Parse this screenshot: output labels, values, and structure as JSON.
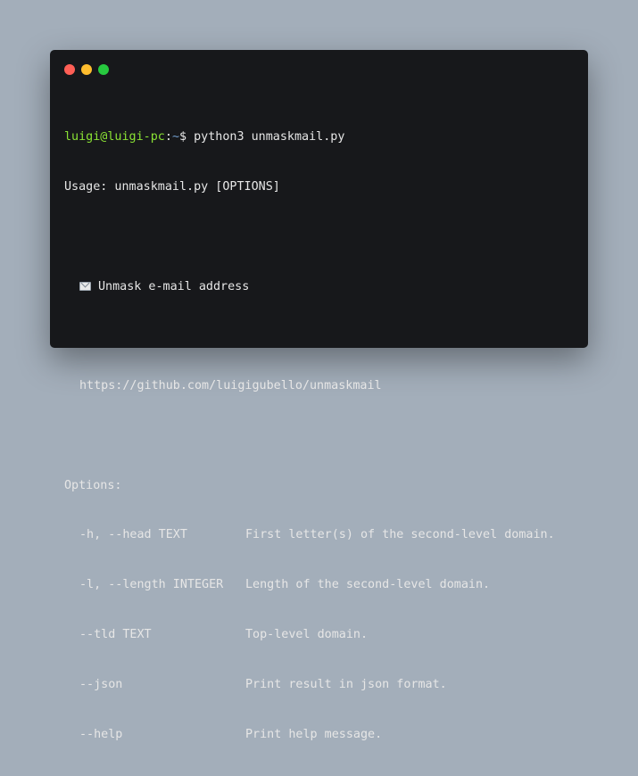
{
  "window": {
    "controls": [
      "close",
      "minimize",
      "maximize"
    ],
    "colors": {
      "close": "#ff5f56",
      "minimize": "#ffbd2e",
      "maximize": "#27c93f"
    }
  },
  "terminal": {
    "prompt": {
      "user": "luigi@luigi-pc",
      "path": "~",
      "symbol": "$",
      "command": "python3 unmaskmail.py"
    },
    "usage": "Usage: unmaskmail.py [OPTIONS]",
    "description_icon": "envelope-icon",
    "description": "Unmask e-mail address",
    "url": "https://github.com/luigigubello/unmaskmail",
    "options_header": "Options:",
    "options": [
      {
        "flag": "-h, --head TEXT",
        "help": "First letter(s) of the second-level domain."
      },
      {
        "flag": "-l, --length INTEGER",
        "help": "Length of the second-level domain."
      },
      {
        "flag": "--tld TEXT",
        "help": "Top-level domain."
      },
      {
        "flag": "--json",
        "help": "Print result in json format."
      },
      {
        "flag": "--help",
        "help": "Print help message."
      }
    ]
  }
}
